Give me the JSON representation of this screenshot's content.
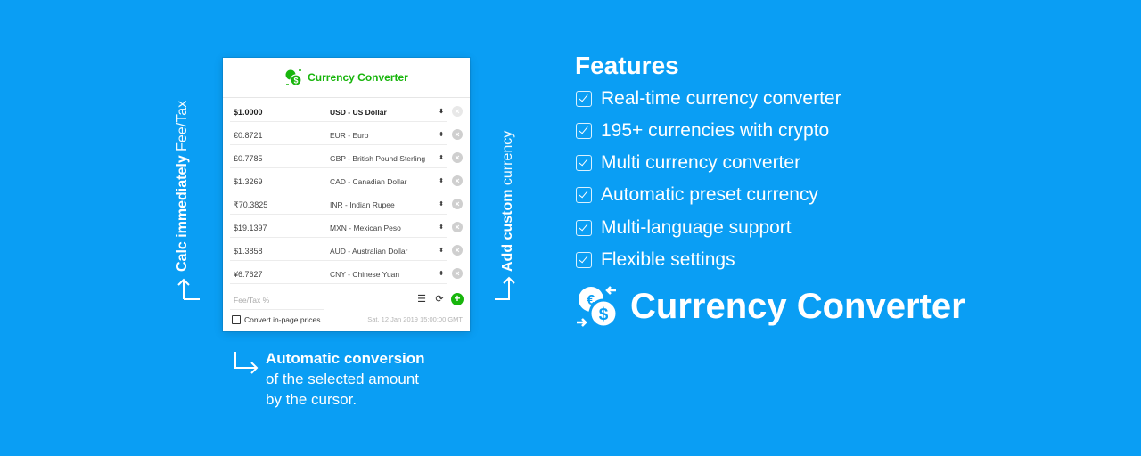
{
  "popup": {
    "title": "Currency Converter",
    "rows": [
      {
        "amount": "$1.0000",
        "currency": "USD - US Dollar"
      },
      {
        "amount": "€0.8721",
        "currency": "EUR - Euro"
      },
      {
        "amount": "£0.7785",
        "currency": "GBP - British Pound Sterling"
      },
      {
        "amount": "$1.3269",
        "currency": "CAD - Canadian Dollar"
      },
      {
        "amount": "₹70.3825",
        "currency": "INR - Indian Rupee"
      },
      {
        "amount": "$19.1397",
        "currency": "MXN - Mexican Peso"
      },
      {
        "amount": "$1.3858",
        "currency": "AUD - Australian Dollar"
      },
      {
        "amount": "¥6.7627",
        "currency": "CNY - Chinese Yuan"
      }
    ],
    "fee_placeholder": "Fee/Tax %",
    "convert_label": "Convert in-page prices",
    "convert_checked": false,
    "timestamp": "Sat, 12 Jan 2019 15:00:00 GMT",
    "icons": {
      "settings": "sliders-icon",
      "refresh": "refresh-currency-icon",
      "add": "plus-circle-icon",
      "remove": "close-circle-icon"
    },
    "accent": "#18b50c"
  },
  "annotations": {
    "left_bold": "Calc immediately",
    "left_light": "Fee/Tax",
    "right_bold": "Add custom",
    "right_light": "currency",
    "bottom_bold": "Automatic conversion",
    "bottom_line2": "of the selected amount",
    "bottom_line3": "by the cursor."
  },
  "features": {
    "title": "Features",
    "items": [
      "Real-time currency converter",
      "195+ currencies with crypto",
      "Multi currency converter",
      "Automatic preset currency",
      "Multi-language support",
      "Flexible settings"
    ]
  },
  "brand": {
    "name": "Currency Converter"
  },
  "colors": {
    "background": "#0a9ef4",
    "accent": "#18b50c"
  }
}
